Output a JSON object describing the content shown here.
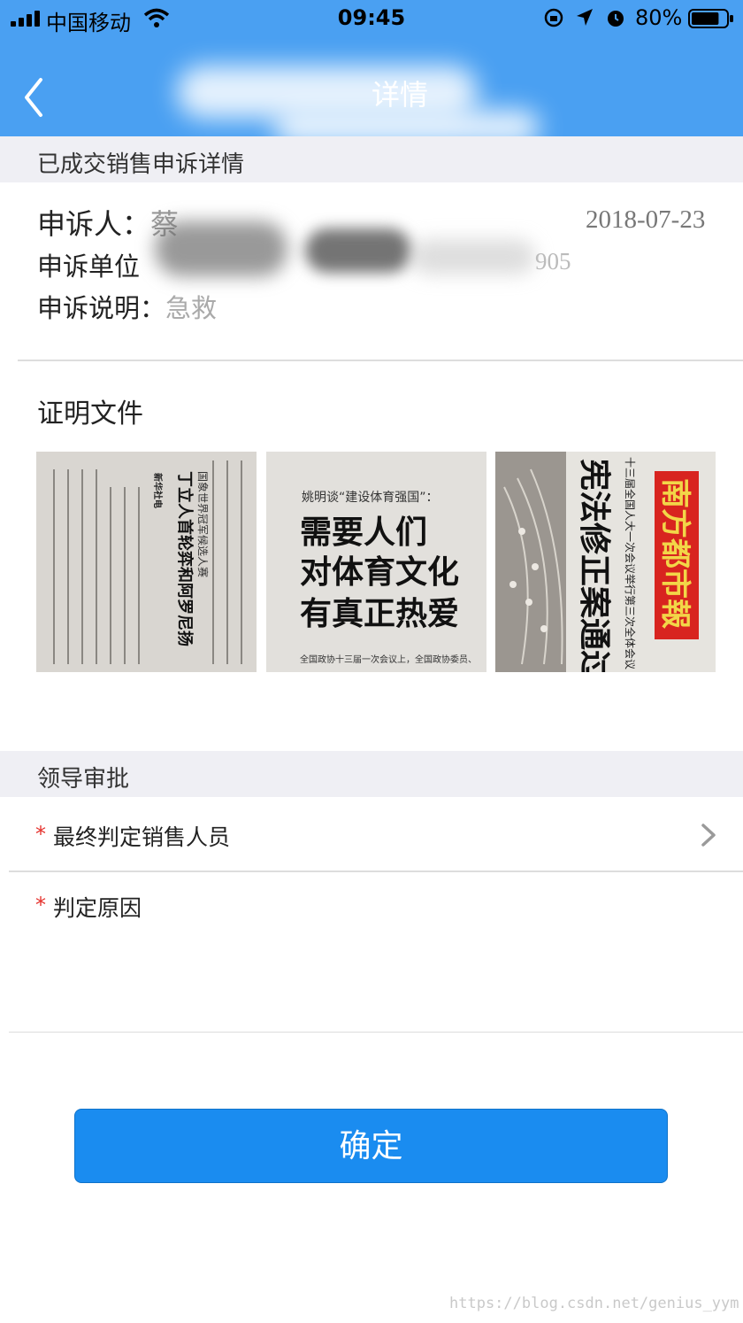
{
  "status_bar": {
    "carrier": "中国移动",
    "time": "09:45",
    "battery": "80%",
    "battery_level": 0.8,
    "icons": [
      "signal-icon",
      "wifi-icon",
      "lock-rotation-icon",
      "location-icon",
      "alarm-icon",
      "battery-icon"
    ]
  },
  "nav": {
    "title_visible": "详情",
    "back_icon": "chevron-left-icon",
    "background": "#4aa0f2"
  },
  "section_detail": {
    "header": "已成交销售申诉详情"
  },
  "complaint": {
    "complainant_label": "申诉人：",
    "complainant_value": "蔡",
    "date": "2018-07-23",
    "unit_label": "申诉单位",
    "unit_value_visible": "905",
    "desc_label": "申诉说明：",
    "desc_value": "急救"
  },
  "proof": {
    "title": "证明文件",
    "images": [
      {
        "headline": "丁立人首轮弈和阿罗尼扬",
        "subhead": "国象世界冠军候选人赛",
        "byline": "新华社电"
      },
      {
        "kicker": "姚明谈“建设体育强国”：",
        "headline_lines": [
          "需要人们",
          "对体育文化",
          "有真正热爱"
        ],
        "body_snippet": "全国政协十三届一次会议上，全国政协委员、"
      },
      {
        "masthead": "南方都市報",
        "headline": "宪法修正案通过",
        "subhead": "十三届全国人大一次会议举行第三次全体会议"
      }
    ]
  },
  "approval": {
    "header": "领导审批",
    "final_salesperson_label": "最终判定销售人员",
    "reason_label": "判定原因",
    "required_mark": "*"
  },
  "confirm_label": "确定",
  "watermark": "https://blog.csdn.net/genius_yym",
  "colors": {
    "accent": "#4aa0f2",
    "button": "#1a8cf0",
    "required": "#e5322d",
    "section_bg": "#efeff4"
  }
}
